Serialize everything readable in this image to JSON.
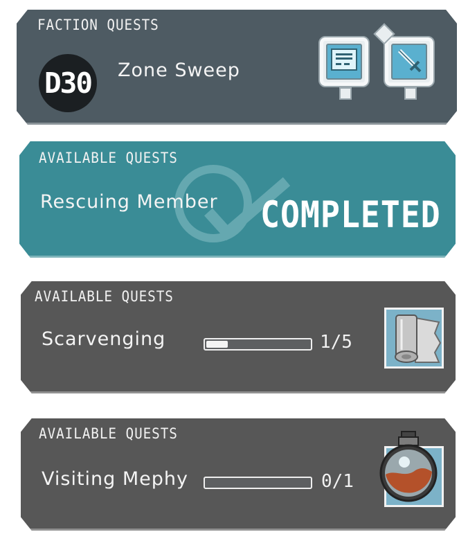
{
  "colors": {
    "faction_bg": "#4e5b63",
    "completed_bg": "#3a8c96",
    "available_bg": "#575757",
    "text": "#f2f2f2"
  },
  "faction": {
    "header": "FACTION QUESTS",
    "level": "D30",
    "quest_name": "Zone Sweep",
    "icons": [
      "quest-board-icon",
      "sword-icon"
    ]
  },
  "completed_card": {
    "header": "AVAILABLE QUESTS",
    "quest_name": "Rescuing Member",
    "status": "COMPLETED",
    "stamp_icon": "checkmark-stamp-icon"
  },
  "quests": [
    {
      "header": "AVAILABLE QUESTS",
      "quest_name": "Scarvenging",
      "progress": "1/5",
      "progress_fraction": 0.2,
      "item_icon": "paper-roll-icon"
    },
    {
      "header": "AVAILABLE QUESTS",
      "quest_name": "Visiting Mephy",
      "progress": "0/1",
      "progress_fraction": 0.0,
      "item_icon": "potion-flask-icon"
    }
  ]
}
